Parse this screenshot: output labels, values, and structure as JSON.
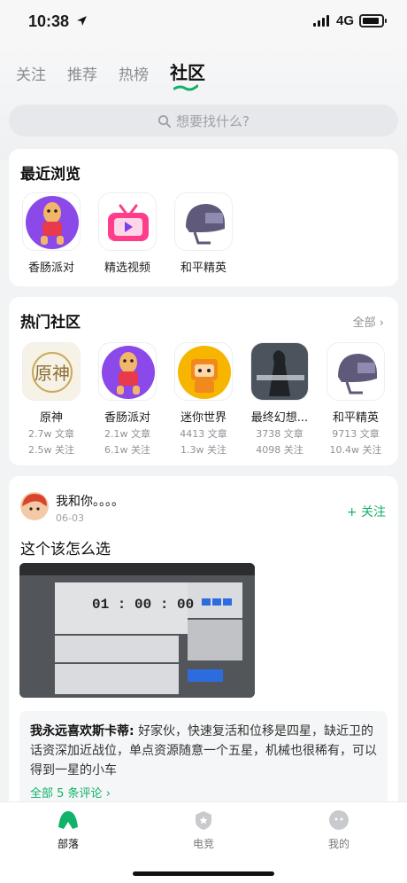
{
  "status": {
    "time": "10:38",
    "network": "4G"
  },
  "tabs": [
    "关注",
    "推荐",
    "热榜",
    "社区"
  ],
  "search": {
    "placeholder": "想要找什么?"
  },
  "recent": {
    "title": "最近浏览",
    "items": [
      {
        "name": "香肠派对",
        "icon": "sausage-party-icon"
      },
      {
        "name": "精选视频",
        "icon": "tv-video-icon"
      },
      {
        "name": "和平精英",
        "icon": "helmet-icon"
      }
    ]
  },
  "hot": {
    "title": "热门社区",
    "all_label": "全部",
    "items": [
      {
        "name": "原神",
        "articles": "2.7w 文章",
        "follows": "2.5w 关注",
        "icon": "genshin-icon"
      },
      {
        "name": "香肠派对",
        "articles": "2.1w 文章",
        "follows": "6.1w 关注",
        "icon": "sausage-party-icon"
      },
      {
        "name": "迷你世界",
        "articles": "4413 文章",
        "follows": "1.3w 关注",
        "icon": "mini-world-icon"
      },
      {
        "name": "最终幻想...",
        "articles": "3738 文章",
        "follows": "4098 关注",
        "icon": "final-fantasy-icon"
      },
      {
        "name": "和平精英",
        "articles": "9713 文章",
        "follows": "10.4w 关注",
        "icon": "helmet-icon"
      }
    ]
  },
  "post": {
    "username": "我和你。。。。",
    "date": "06-03",
    "follow_label": "关注",
    "title": "这个该怎么选",
    "image": {
      "timer": "01 : 00 : 00"
    },
    "comment_author": "我永远喜欢斯卡蒂:",
    "comment_text": "好家伙，快速复活和位移是四星，缺近卫的话资深加近战位，单点资源随意一个五星，机械也很稀有，可以得到一星的小车",
    "comment_more": "全部 5 条评论"
  },
  "nav": [
    {
      "label": "部落",
      "icon": "tribe-icon",
      "active": true
    },
    {
      "label": "电竞",
      "icon": "esports-icon",
      "active": false
    },
    {
      "label": "我的",
      "icon": "profile-icon",
      "active": false
    }
  ],
  "colors": {
    "accent": "#11b36a"
  }
}
